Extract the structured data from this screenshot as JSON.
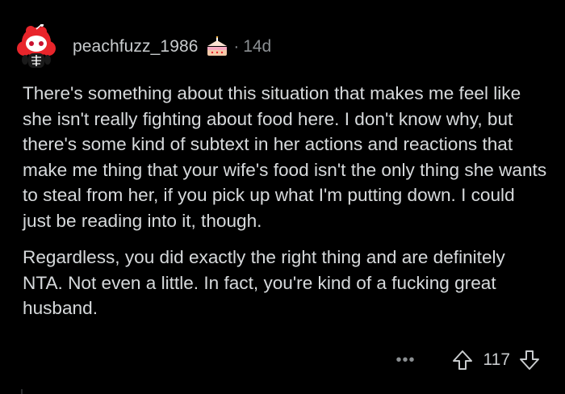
{
  "comment": {
    "username": "peachfuzz_1986",
    "separator": "·",
    "age": "14d",
    "paragraphs": [
      "There's something about this situation that makes me feel like she isn't really fighting about food here. I don't know why, but there's some kind of subtext in her actions and reactions that make me thing that your wife's food isn't the only thing she wants to steal from her, if you pick up what I'm putting down. I could just be reading into it, though.",
      "Regardless, you did exactly the right thing and are definitely NTA. Not even a little. In fact, you're kind of a fucking great husband."
    ],
    "more_label": "•••",
    "score": "117"
  },
  "icons": {
    "avatar": "snoo-avatar",
    "cake": "cake-day-icon",
    "more": "more-options-icon",
    "upvote": "upvote-arrow-icon",
    "downvote": "downvote-arrow-icon"
  },
  "colors": {
    "background": "#000000",
    "text": "#d7dadc",
    "muted": "#8b8f92",
    "avatar_accent": "#e8252b"
  }
}
